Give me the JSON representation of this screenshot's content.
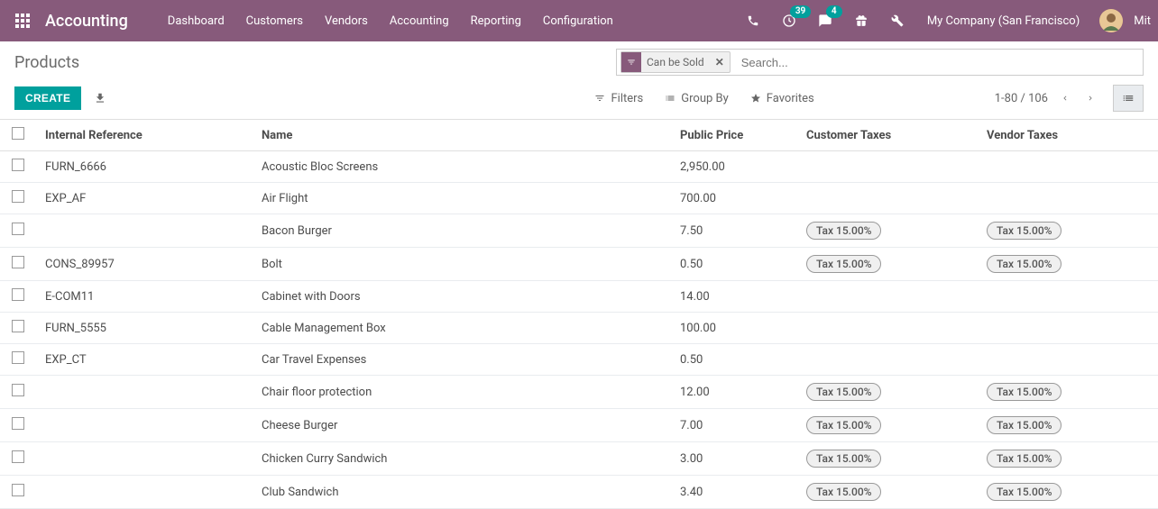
{
  "navbar": {
    "brand": "Accounting",
    "menu": [
      "Dashboard",
      "Customers",
      "Vendors",
      "Accounting",
      "Reporting",
      "Configuration"
    ],
    "activities_badge": "39",
    "messages_badge": "4",
    "company": "My Company (San Francisco)",
    "username": "Mit"
  },
  "breadcrumb": "Products",
  "search": {
    "facet_label": "Can be Sold",
    "placeholder": "Search..."
  },
  "buttons": {
    "create": "CREATE"
  },
  "tools": {
    "filters": "Filters",
    "group_by": "Group By",
    "favorites": "Favorites"
  },
  "pager": {
    "range": "1-80 / 106"
  },
  "table": {
    "headers": {
      "ref": "Internal Reference",
      "name": "Name",
      "price": "Public Price",
      "cust_tax": "Customer Taxes",
      "vend_tax": "Vendor Taxes"
    },
    "tax_label": "Tax 15.00%",
    "rows": [
      {
        "ref": "FURN_6666",
        "name": "Acoustic Bloc Screens",
        "price": "2,950.00",
        "cust_tax": false,
        "vend_tax": false
      },
      {
        "ref": "EXP_AF",
        "name": "Air Flight",
        "price": "700.00",
        "cust_tax": false,
        "vend_tax": false
      },
      {
        "ref": "",
        "name": "Bacon Burger",
        "price": "7.50",
        "cust_tax": true,
        "vend_tax": true
      },
      {
        "ref": "CONS_89957",
        "name": "Bolt",
        "price": "0.50",
        "cust_tax": true,
        "vend_tax": true
      },
      {
        "ref": "E-COM11",
        "name": "Cabinet with Doors",
        "price": "14.00",
        "cust_tax": false,
        "vend_tax": false
      },
      {
        "ref": "FURN_5555",
        "name": "Cable Management Box",
        "price": "100.00",
        "cust_tax": false,
        "vend_tax": false
      },
      {
        "ref": "EXP_CT",
        "name": "Car Travel Expenses",
        "price": "0.50",
        "cust_tax": false,
        "vend_tax": false
      },
      {
        "ref": "",
        "name": "Chair floor protection",
        "price": "12.00",
        "cust_tax": true,
        "vend_tax": true
      },
      {
        "ref": "",
        "name": "Cheese Burger",
        "price": "7.00",
        "cust_tax": true,
        "vend_tax": true
      },
      {
        "ref": "",
        "name": "Chicken Curry Sandwich",
        "price": "3.00",
        "cust_tax": true,
        "vend_tax": true
      },
      {
        "ref": "",
        "name": "Club Sandwich",
        "price": "3.40",
        "cust_tax": true,
        "vend_tax": true
      }
    ]
  }
}
